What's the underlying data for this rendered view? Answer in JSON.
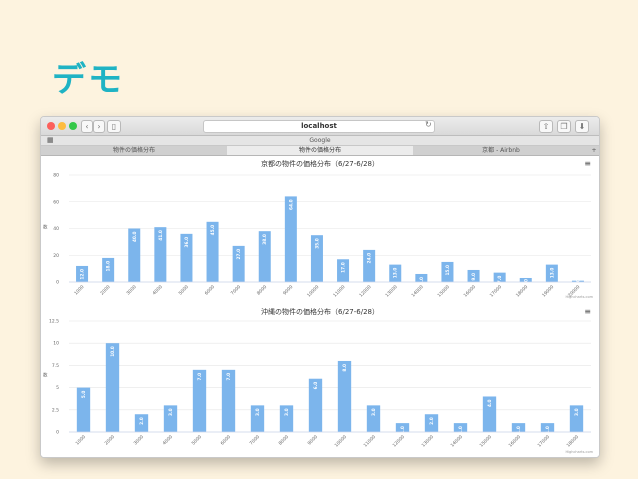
{
  "slide": {
    "title": "デモ"
  },
  "browser": {
    "url": "localhost",
    "bookmark_label": "Google",
    "tabs": [
      {
        "label": "物件の価格分布",
        "active": false
      },
      {
        "label": "物件の価格分布",
        "active": true
      },
      {
        "label": "京都 - Airbnb",
        "active": false
      }
    ]
  },
  "charts": {
    "credit": "Highcharts.com",
    "menu_icon": "hamburger-menu-icon"
  },
  "chart_data": [
    {
      "type": "bar",
      "title": "京都の物件の価格分布（6/27-6/28）",
      "ylabel": "数",
      "ylim": [
        0,
        80
      ],
      "yticks": [
        0,
        20,
        40,
        60,
        80
      ],
      "categories": [
        "1000",
        "2000",
        "3000",
        "4000",
        "5000",
        "6000",
        "7000",
        "8000",
        "9000",
        "10000",
        "11000",
        "12000",
        "13000",
        "14000",
        "15000",
        "16000",
        "17000",
        "18000",
        "19000",
        "20000"
      ],
      "values": [
        12.0,
        18.0,
        40.0,
        41.0,
        36.0,
        45.0,
        27.0,
        38.0,
        64.0,
        35.0,
        17.0,
        24.0,
        13.0,
        6.0,
        15.0,
        9.0,
        7.0,
        3.0,
        13.0,
        1.0
      ],
      "labels": [
        "12.0",
        "18.0",
        "40.0",
        "41.0",
        "36.0",
        "45.0",
        "27.0",
        "38.0",
        "64.0",
        "35.0",
        "17.0",
        "24.0",
        "13.0",
        "6.0",
        "15.0",
        "9.0",
        "7.0",
        "3.0",
        "13.0",
        "1.0"
      ],
      "color": "#7cb5ec"
    },
    {
      "type": "bar",
      "title": "沖縄の物件の価格分布（6/27-6/28）",
      "ylabel": "数",
      "ylim": [
        0,
        12.5
      ],
      "yticks": [
        0,
        2.5,
        5,
        7.5,
        10,
        12.5
      ],
      "categories": [
        "1000",
        "2000",
        "3000",
        "4000",
        "5000",
        "6000",
        "7000",
        "8000",
        "9000",
        "10000",
        "11000",
        "12000",
        "13000",
        "14000",
        "15000",
        "16000",
        "17000",
        "18000"
      ],
      "values": [
        5.0,
        10.0,
        2.0,
        3.0,
        7.0,
        7.0,
        3.0,
        3.0,
        6.0,
        8.0,
        3.0,
        1.0,
        2.0,
        1.0,
        4.0,
        1.0,
        1.0,
        3.0
      ],
      "labels": [
        "5.0",
        "10.0",
        "2.0",
        "3.0",
        "7.0",
        "7.0",
        "3.0",
        "3.0",
        "6.0",
        "8.0",
        "3.0",
        "1.0",
        "2.0",
        "1.0",
        "4.0",
        "1.0",
        "1.0",
        "3.0"
      ],
      "color": "#7cb5ec"
    }
  ]
}
